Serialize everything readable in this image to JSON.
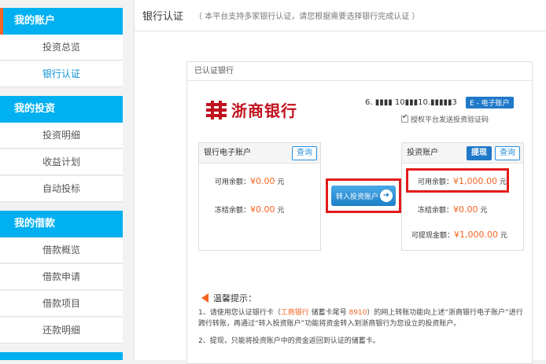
{
  "sidebar": {
    "sections": [
      {
        "title": "我的账户",
        "items": [
          "投资总览",
          "银行认证"
        ]
      },
      {
        "title": "我的投资",
        "items": [
          "投资明细",
          "收益计划",
          "自动投标"
        ]
      },
      {
        "title": "我的借款",
        "items": [
          "借款概览",
          "借款申请",
          "借款项目",
          "还款明细"
        ]
      }
    ]
  },
  "main": {
    "title": "银行认证",
    "note": "（ 本平台支持多家银行认证，请您根据需要选择银行完成认证 ）",
    "certified_label": "已认证银行",
    "bank_name": "浙商银行",
    "account_number": "6. ▮▮▮▮ 10▮▮▮10.▮▮▮▮▮3",
    "eaccount_badge": "E - 电子账户",
    "authorize_label": "授权平台发送投资验证码",
    "bank_account": {
      "title": "银行电子账户",
      "query_button": "查询",
      "available_label": "可用余额：",
      "available_value": "¥0.00",
      "frozen_label": "冻结余额：",
      "frozen_value": "¥0.00",
      "unit": "元"
    },
    "transfer_button": "转入投资账户",
    "invest_account": {
      "title": "投资账户",
      "withdraw_button": "提现",
      "query_button": "查询",
      "available_label": "可用余额：",
      "available_value": "¥1,000.00",
      "frozen_label": "冻结余额：",
      "frozen_value": "¥0.00",
      "withdrawable_label": "可提现金额：",
      "withdrawable_value": "¥1,000.00",
      "unit": "元"
    },
    "tips": {
      "title": "温馨提示：",
      "line1_a": "1、请使用您认证银行卡（",
      "line1_bank": "工商银行",
      "line1_b": " 储蓄卡尾号 ",
      "line1_tail": "8910",
      "line1_c": "）的网上转账功能向上述“浙商银行电子账户”进行跨行转账，再通过“转入投资账户”功能将资金转入到浙商银行为您设立的投资账户。",
      "line2": "2、提现，只能将投资账户中的资金返回到认证的储蓄卡。"
    }
  }
}
